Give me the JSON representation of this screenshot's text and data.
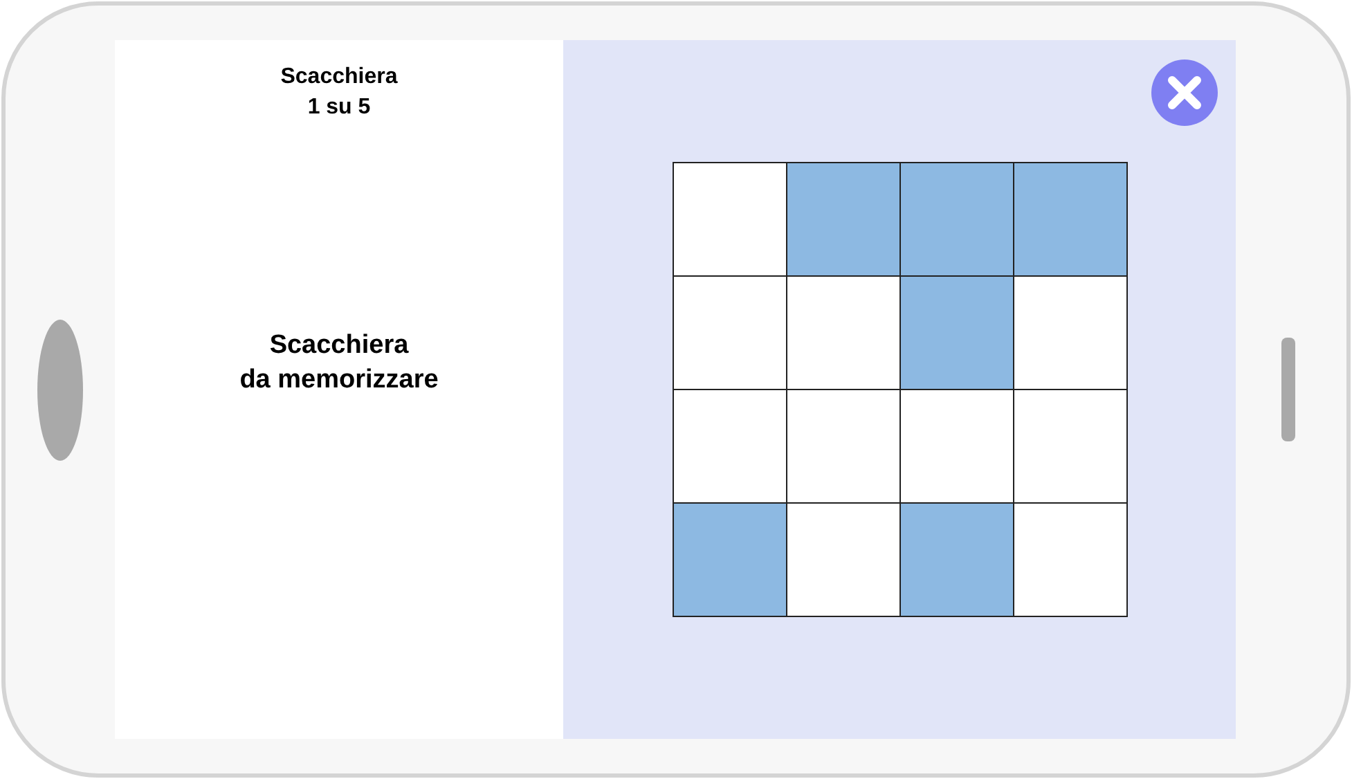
{
  "header": {
    "title": "Scacchiera",
    "counter": "1 su 5"
  },
  "prompt": "Scacchiera\nda memorizzare",
  "board": {
    "rows": [
      {
        "cells": [
          {
            "highlighted": false
          },
          {
            "highlighted": true
          },
          {
            "highlighted": true
          },
          {
            "highlighted": true
          }
        ]
      },
      {
        "cells": [
          {
            "highlighted": false
          },
          {
            "highlighted": false
          },
          {
            "highlighted": true
          },
          {
            "highlighted": false
          }
        ]
      },
      {
        "cells": [
          {
            "highlighted": false
          },
          {
            "highlighted": false
          },
          {
            "highlighted": false
          },
          {
            "highlighted": false
          }
        ]
      },
      {
        "cells": [
          {
            "highlighted": true
          },
          {
            "highlighted": false
          },
          {
            "highlighted": true
          },
          {
            "highlighted": false
          }
        ]
      }
    ]
  }
}
